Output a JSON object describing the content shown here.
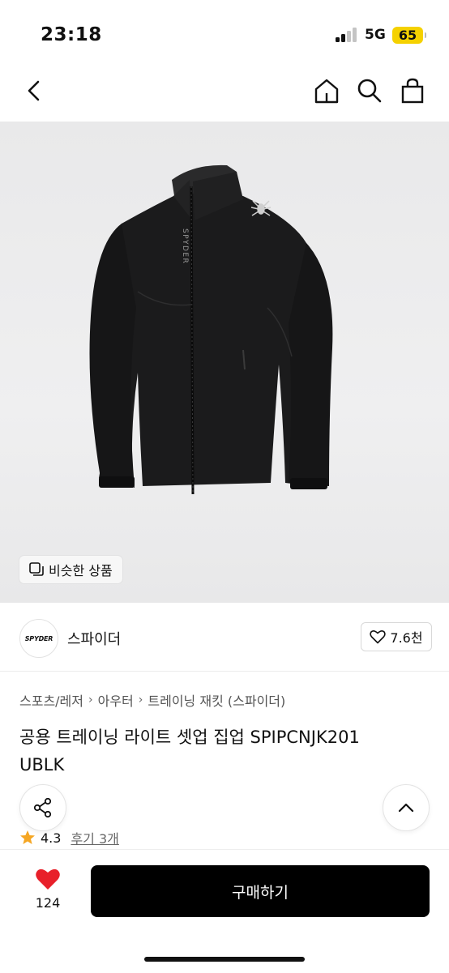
{
  "status_bar": {
    "time": "23:18",
    "network": "5G",
    "battery": "65"
  },
  "nav": {
    "icons": [
      "back-icon",
      "home-icon",
      "search-icon",
      "shopping-bag-icon"
    ]
  },
  "hero": {
    "similar_label": "비슷한 상품",
    "chest_logo": "SPYDER"
  },
  "brand": {
    "logo_text": "SPYDER",
    "name": "스파이더",
    "likes": "7.6천"
  },
  "breadcrumb": [
    "스포츠/레저",
    "아우터",
    "트레이닝 재킷 (스파이더)"
  ],
  "product": {
    "title_line1": "공용 트레이닝 라이트 셋업 집업 SPIPCNJK201",
    "title_line2": "UBLK"
  },
  "rating": {
    "score": "4.3",
    "reviews": "후기 3개"
  },
  "bottom": {
    "wish_count": "124",
    "buy_label": "구매하기"
  },
  "colors": {
    "accent": "#000000",
    "heart": "#e8202a",
    "star": "#f5a623",
    "battery": "#f5d100"
  }
}
